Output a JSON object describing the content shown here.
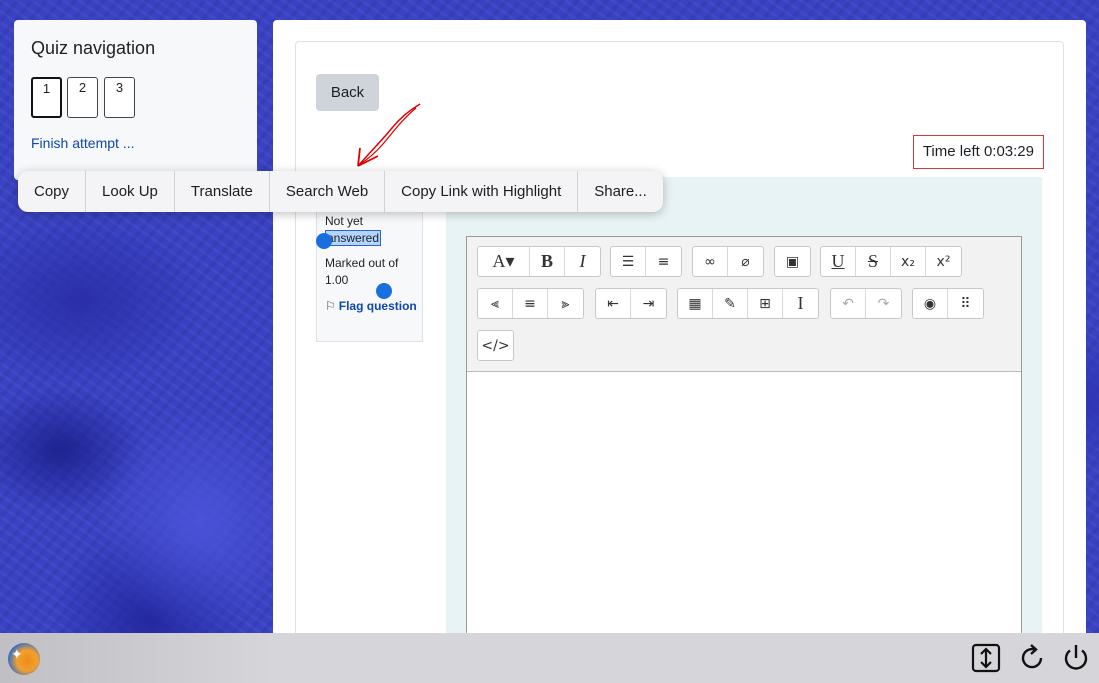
{
  "quiz_nav": {
    "title": "Quiz navigation",
    "questions": [
      "1",
      "2",
      "3"
    ],
    "finish_link": "Finish attempt ..."
  },
  "main": {
    "back_label": "Back",
    "timer": "Time left 0:03:29",
    "question_info": {
      "status_part1": "Not yet",
      "status_part2": "answered",
      "marked": "Marked out of 1.00",
      "flag": "Flag question"
    }
  },
  "context_menu": {
    "items": [
      "Copy",
      "Look Up",
      "Translate",
      "Search Web",
      "Copy Link with Highlight",
      "Share..."
    ]
  },
  "editor": {
    "toolbar_icons": [
      "font-size-icon",
      "bold-icon",
      "italic-icon",
      "unordered-list-icon",
      "ordered-list-icon",
      "link-icon",
      "unlink-icon",
      "image-icon",
      "underline-icon",
      "strikethrough-icon",
      "subscript-icon",
      "superscript-icon",
      "align-left-icon",
      "align-center-icon",
      "align-right-icon",
      "outdent-icon",
      "indent-icon",
      "calculator-icon",
      "edit-icon",
      "table-icon",
      "cursor-icon",
      "undo-icon",
      "redo-icon",
      "accessibility-icon",
      "braille-icon",
      "html-icon"
    ]
  },
  "colors": {
    "link": "#0f47ad",
    "timer_border": "#dd3333",
    "selection_handle": "#1a6fe0",
    "annotation": "#e00000"
  }
}
